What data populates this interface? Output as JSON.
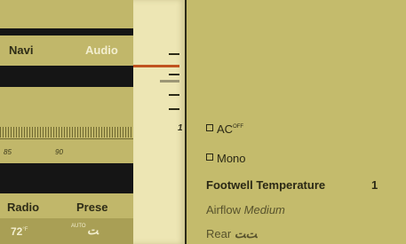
{
  "top_nav": {
    "navi": "Navi",
    "audio": "Audio"
  },
  "radio_scale": {
    "ticks": [
      "85",
      "90"
    ]
  },
  "bottom_bar": {
    "radio": "Radio",
    "presets": "Prese",
    "temperature": "72",
    "temperature_unit": "°F",
    "auto_label": "AUTO",
    "fan_symbol": "ﺖ"
  },
  "strip": {
    "marker_number": "1"
  },
  "menu": {
    "ac_label": "AC",
    "ac_state": "OFF",
    "mono_label": "Mono",
    "footwell_label": "Footwell Temperature",
    "footwell_value": "1",
    "airflow_label": "Airflow",
    "airflow_value": "Medium",
    "rear_label": "Rear",
    "rear_symbol": "ﺖﺖ"
  },
  "colors": {
    "accent": "#c1531f",
    "screen_olive": "#c4bb6c",
    "strip_cream": "#ede6b4",
    "text_dark": "#2a2815"
  }
}
